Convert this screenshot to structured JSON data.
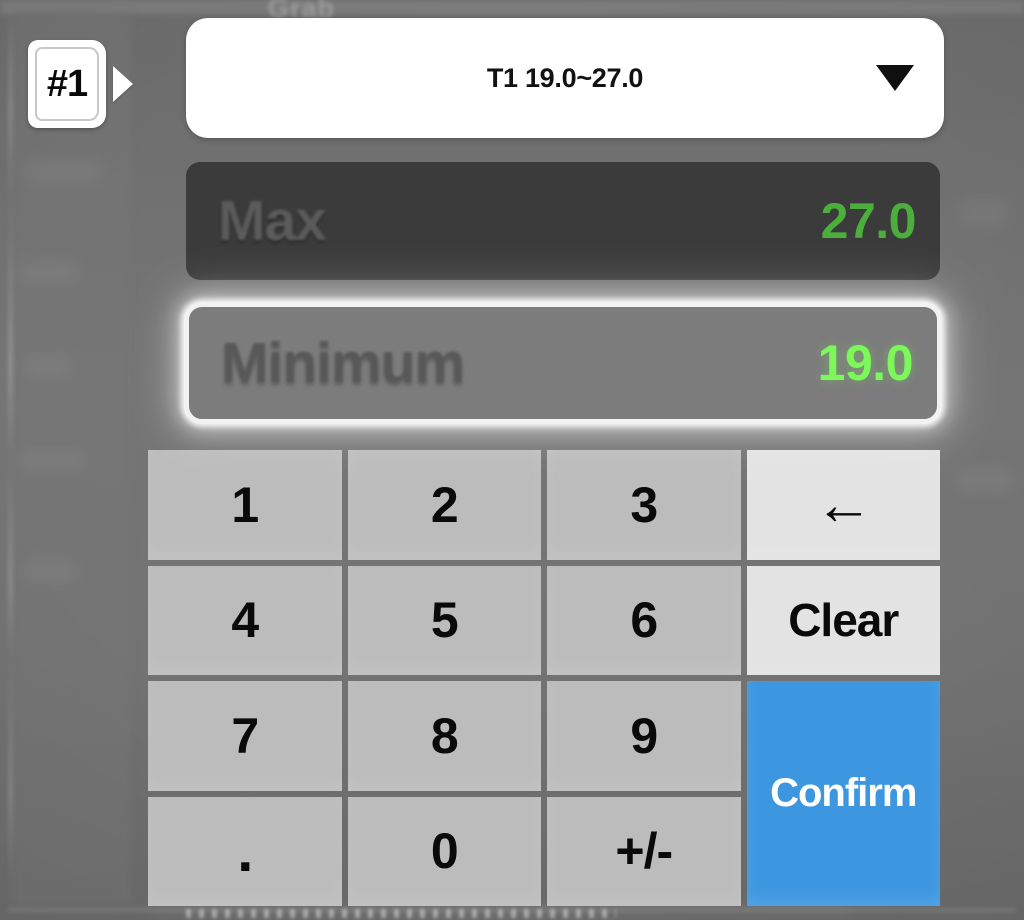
{
  "overlay": {
    "background_ghost_text": "Grab",
    "accent_blue": "#3d97e0",
    "value_green_active": "#7cf95a",
    "value_green_inactive": "#4caf3c"
  },
  "tab_marker": {
    "label": "#1",
    "arrow_icon": "triangle-right-icon"
  },
  "dropdown": {
    "selected_label": "T1 19.0~27.0",
    "caret_icon": "chevron-down-icon"
  },
  "fields": [
    {
      "name": "max",
      "label": "Max",
      "value": "27.0",
      "selected": false
    },
    {
      "name": "minimum",
      "label": "Minimum",
      "value": "19.0",
      "selected": true
    }
  ],
  "keypad": {
    "keys": [
      {
        "name": "key-1",
        "label": "1",
        "type": "digit"
      },
      {
        "name": "key-2",
        "label": "2",
        "type": "digit"
      },
      {
        "name": "key-3",
        "label": "3",
        "type": "digit"
      },
      {
        "name": "key-backspace",
        "label": "←",
        "type": "action",
        "icon": "backspace-arrow-icon"
      },
      {
        "name": "key-4",
        "label": "4",
        "type": "digit"
      },
      {
        "name": "key-5",
        "label": "5",
        "type": "digit"
      },
      {
        "name": "key-6",
        "label": "6",
        "type": "digit"
      },
      {
        "name": "key-clear",
        "label": "Clear",
        "type": "action"
      },
      {
        "name": "key-7",
        "label": "7",
        "type": "digit"
      },
      {
        "name": "key-8",
        "label": "8",
        "type": "digit"
      },
      {
        "name": "key-9",
        "label": "9",
        "type": "digit"
      },
      {
        "name": "key-confirm",
        "label": "Confirm",
        "type": "confirm"
      },
      {
        "name": "key-decimal",
        "label": ".",
        "type": "digit"
      },
      {
        "name": "key-0",
        "label": "0",
        "type": "digit"
      },
      {
        "name": "key-sign",
        "label": "+/-",
        "type": "digit"
      }
    ]
  }
}
